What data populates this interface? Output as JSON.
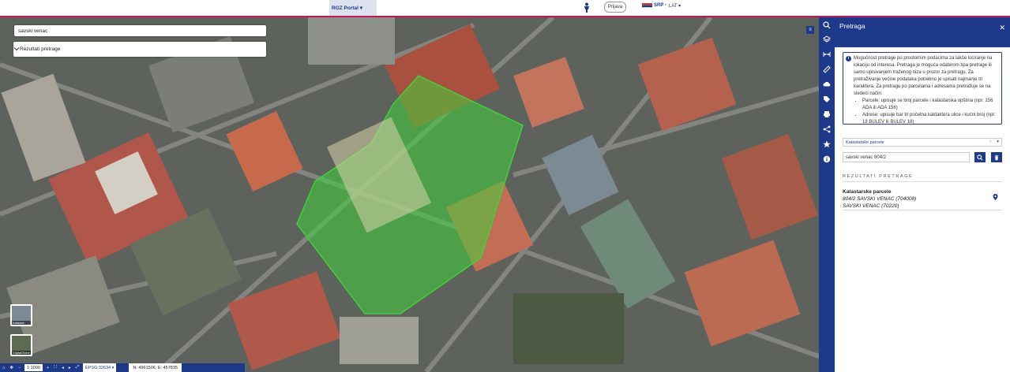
{
  "header": {
    "portal_label": "RGZ Portal",
    "login_label": "Prijava",
    "lang_current": "SRP",
    "lang_alt": "LAT"
  },
  "map": {
    "search_value": "savski venac",
    "results_dropdown": "Rezultati pretrage",
    "basemaps": [
      {
        "label": "Katastar"
      },
      {
        "label": "DigitalGlobe"
      }
    ],
    "scale": "1:1000",
    "crs": "EPSG:32634",
    "coordinates": "N: 4961506, E: 457835"
  },
  "panel": {
    "title": "Pretraga",
    "info_text": "Mogućnost pretrage po prostornim podacima za lakše lociranje na lokaciju od interesa. Pretraga je moguća odabirom tipa pretrage ili samo upisivanjem traženog niza u prozor za pretragu. Za pretraživanje većine podataka potrebno je upisati najmanje tri karaktera. Za pretragu po parcelama i adresama pretražuje se na sledeći način:",
    "info_items": [
      "Parcele: upisuje se broj parcele i katastarska opština (npr. 156 ADA ili ADA 156)",
      "Adrese: upisuje bar tri početna kaktaktera ulice i kućni broj (npr. 18 BULEV ili BULEV 18)"
    ],
    "search_type": "Katastarske parcele",
    "query_value": "savski venac 804/2",
    "results_label": "REZULTATI PRETRAGE",
    "result": {
      "type": "Katastarske parcele",
      "line1": "804/2 SAVSKI VENAC (704008)",
      "line2": "SAVSKI VENAC (70220)"
    }
  },
  "colors": {
    "brand": "#1d3a8a",
    "accent": "#c2185b",
    "highlight": "#3fd13a"
  }
}
